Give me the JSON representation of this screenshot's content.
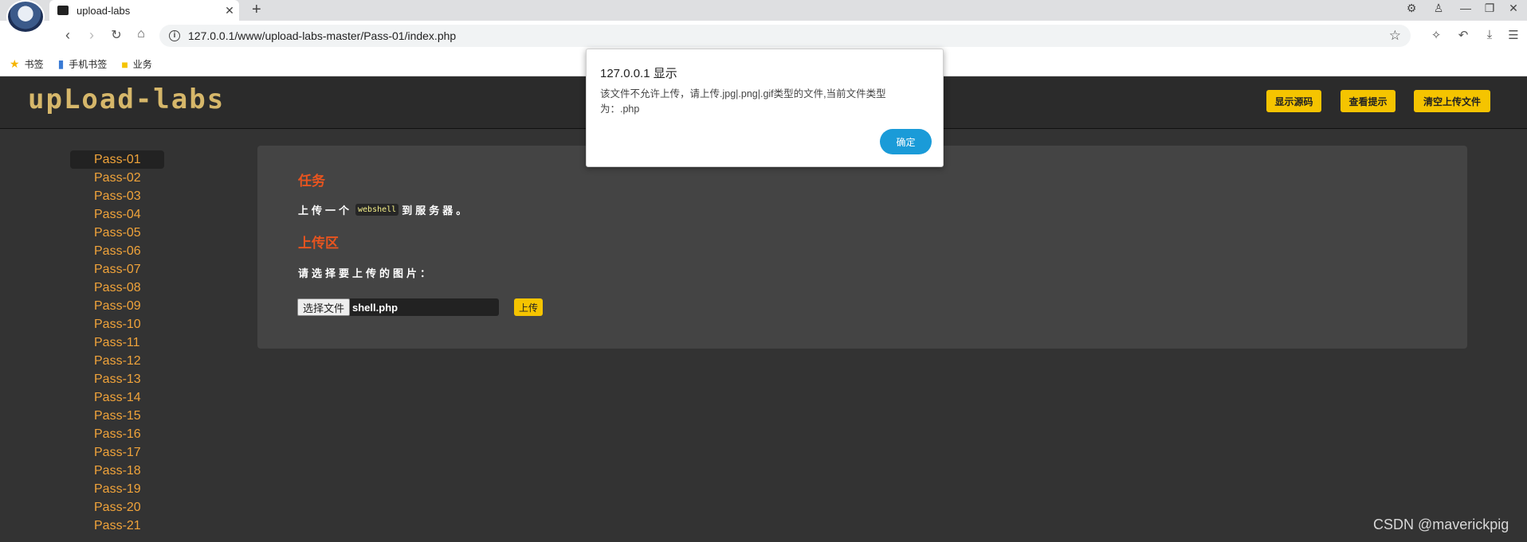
{
  "browser": {
    "tab_title": "upload-labs",
    "url": "127.0.0.1/www/upload-labs-master/Pass-01/index.php",
    "bookmarks": [
      {
        "icon": "star-icon",
        "label": "书签"
      },
      {
        "icon": "mobile-bookmark-icon",
        "label": "手机书签"
      },
      {
        "icon": "folder-icon",
        "label": "业务"
      }
    ]
  },
  "header": {
    "logo": "upLoad-labs",
    "buttons": [
      "显示源码",
      "查看提示",
      "清空上传文件"
    ]
  },
  "sidebar": {
    "items": [
      "Pass-01",
      "Pass-02",
      "Pass-03",
      "Pass-04",
      "Pass-05",
      "Pass-06",
      "Pass-07",
      "Pass-08",
      "Pass-09",
      "Pass-10",
      "Pass-11",
      "Pass-12",
      "Pass-13",
      "Pass-14",
      "Pass-15",
      "Pass-16",
      "Pass-17",
      "Pass-18",
      "Pass-19",
      "Pass-20",
      "Pass-21"
    ],
    "active": "Pass-01"
  },
  "main": {
    "task_heading": "任务",
    "task_prefix": "上传一个",
    "task_code": "webshell",
    "task_suffix": "到服务器。",
    "upload_heading": "上传区",
    "choose_label": "请选择要上传的图片：",
    "file_button": "选择文件",
    "file_name": "shell.php",
    "upload_button": "上传"
  },
  "dialog": {
    "title": "127.0.0.1 显示",
    "message": "该文件不允许上传，请上传.jpg|.png|.gif类型的文件,当前文件类型为：.php",
    "ok": "确定"
  },
  "watermark": "CSDN @maverickpig",
  "colors": {
    "accent_yellow": "#f5c400",
    "heading_orange": "#e8541f",
    "sidebar_link": "#f0a33a",
    "dialog_button": "#1a9bd8"
  }
}
